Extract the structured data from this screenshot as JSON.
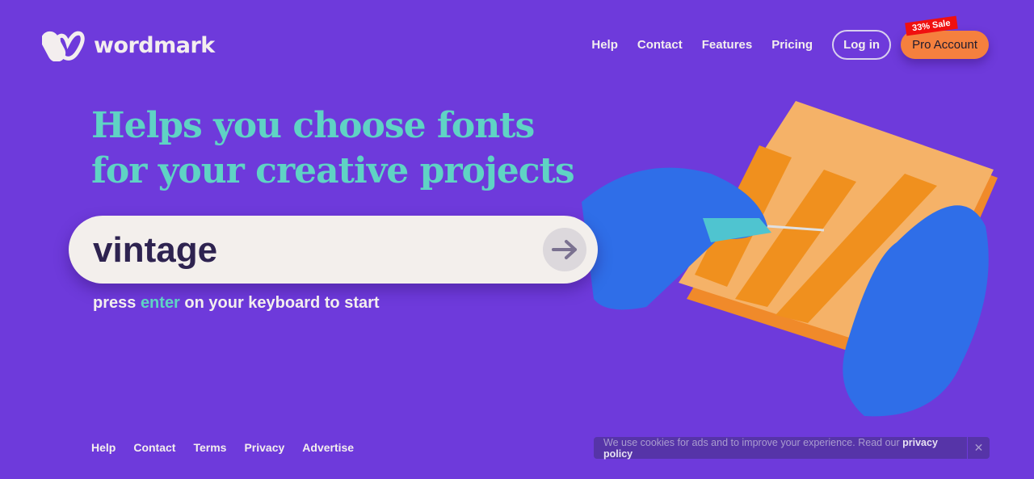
{
  "brand": {
    "name": "wordmark"
  },
  "nav": {
    "items": [
      "Help",
      "Contact",
      "Features",
      "Pricing"
    ],
    "login": "Log in",
    "pro": "Pro Account",
    "sale_badge": "33% Sale"
  },
  "hero": {
    "title_line1": "Helps you choose fonts",
    "title_line2": "for your creative projects"
  },
  "search": {
    "value": "vintage",
    "submit_icon": "arrow-right-icon"
  },
  "hint": {
    "before": "press ",
    "key": "enter",
    "after": " on your keyboard to start"
  },
  "footer": {
    "links": [
      "Help",
      "Contact",
      "Terms",
      "Privacy",
      "Advertise"
    ]
  },
  "cookie": {
    "text": "We use cookies for ads and to improve your experience. Read our ",
    "link": "privacy policy",
    "close": "✕"
  },
  "colors": {
    "background": "#6e3adb",
    "accent": "#5fd3c4",
    "pro_button": "#f5803e",
    "sale": "#f01010"
  }
}
